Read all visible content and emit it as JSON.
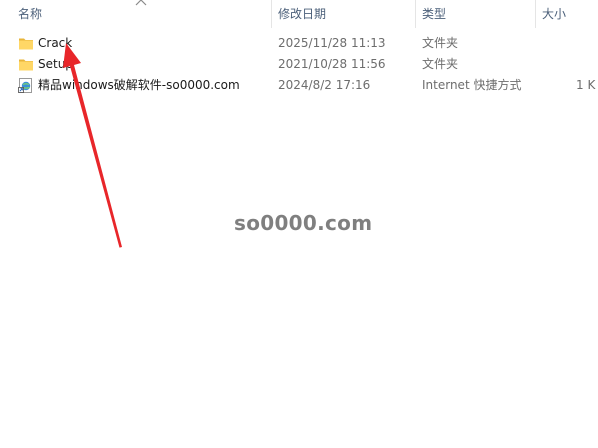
{
  "columns": {
    "name": "名称",
    "date": "修改日期",
    "type": "类型",
    "size": "大小"
  },
  "files": [
    {
      "icon": "folder-icon",
      "name": "Crack",
      "date": "2025/11/28 11:13",
      "type": "文件夹",
      "size": ""
    },
    {
      "icon": "folder-icon",
      "name": "Setup",
      "date": "2021/10/28 11:56",
      "type": "文件夹",
      "size": ""
    },
    {
      "icon": "internet-shortcut-icon",
      "name": "精品windows破解软件-so0000.com",
      "date": "2024/8/2 17:16",
      "type": "Internet 快捷方式",
      "size": "1 K"
    }
  ],
  "watermark": "so0000.com",
  "colors": {
    "folder": "#ffd766",
    "folder_dark": "#e8b53a",
    "arrow": "#e8262a",
    "header_text": "#4c607a"
  }
}
